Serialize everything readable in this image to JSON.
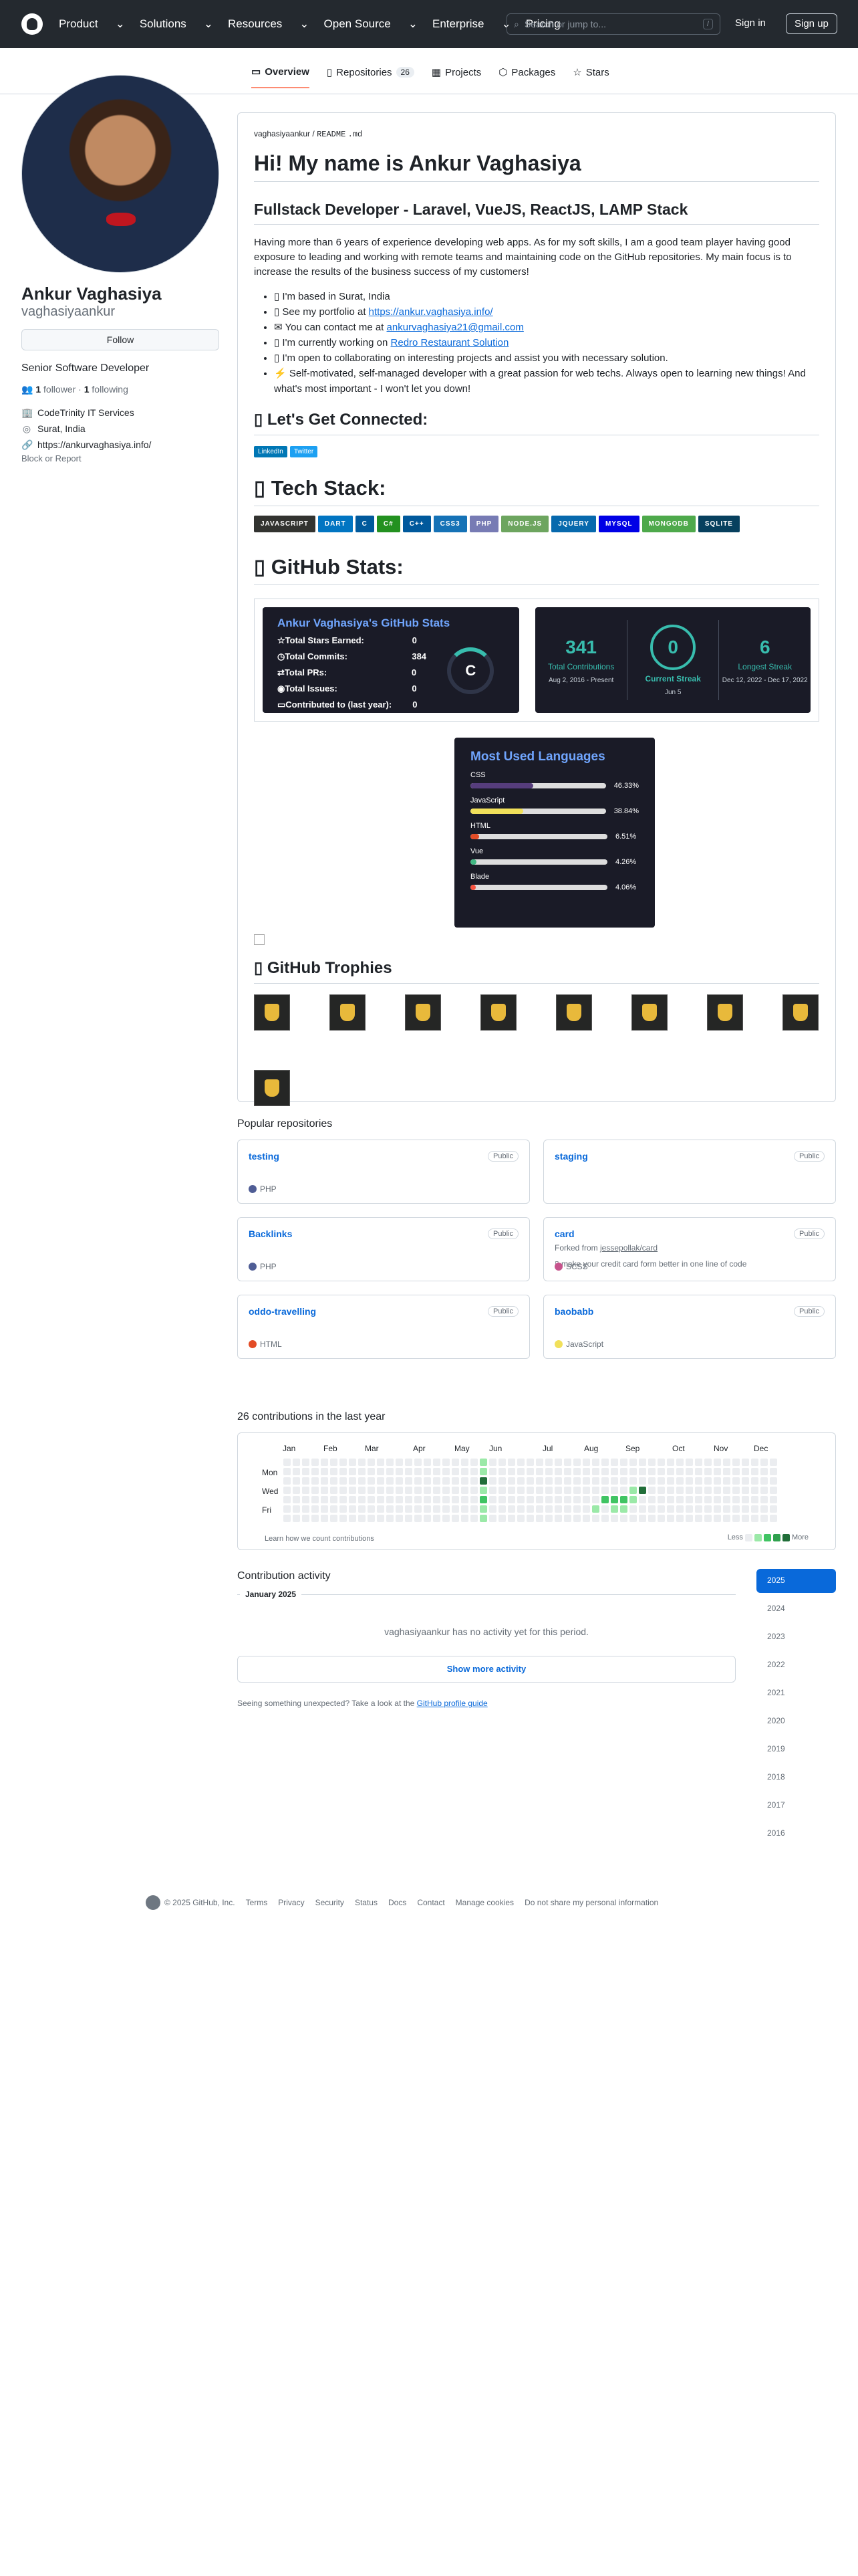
{
  "header": {
    "nav": [
      "Product",
      "Solutions",
      "Resources",
      "Open Source",
      "Enterprise",
      "Pricing"
    ],
    "search_placeholder": "Search or jump to...",
    "search_key": "/",
    "signin": "Sign in",
    "signup": "Sign up"
  },
  "tabs": [
    {
      "label": "Overview"
    },
    {
      "label": "Repositories",
      "count": "26"
    },
    {
      "label": "Projects"
    },
    {
      "label": "Packages"
    },
    {
      "label": "Stars"
    }
  ],
  "profile": {
    "name": "Ankur Vaghasiya",
    "username": "vaghasiyaankur",
    "follow": "Follow",
    "bio": "Senior Software Developer",
    "followers": "1",
    "followers_label": "follower",
    "following": "1",
    "following_label": "following",
    "company": "CodeTrinity IT Services",
    "location": "Surat, India",
    "website": "https://ankurvaghasiya.info/",
    "block": "Block or Report"
  },
  "readme": {
    "path_user": "vaghasiyaankur",
    "path_file": "README",
    "path_ext": ".md",
    "h1": "Hi! My name is Ankur Vaghasiya",
    "h2": "Fullstack Developer - Laravel, VueJS, ReactJS, LAMP Stack",
    "intro": "Having more than 6 years of experience developing web apps. As for my soft skills, I am a good team player having good exposure to leading and working with remote teams and maintaining code on the GitHub repositories. My main focus is to increase the results of the business success of my customers!",
    "bullets": [
      {
        "t": "I'm based in Surat, India"
      },
      {
        "t": "See my portfolio at ",
        "l": "https://ankur.vaghasiya.info/"
      },
      {
        "t": "You can contact me at ",
        "l": "ankurvaghasiya21@gmail.com"
      },
      {
        "t": "I'm currently working on ",
        "l": "Redro Restaurant Solution"
      },
      {
        "t": "I'm open to collaborating on interesting projects and assist you with necessary solution."
      },
      {
        "t": "Self-motivated, self-managed developer with a great passion for web techs. Always open to learning new things! And what's most important - I won't let you down!"
      }
    ],
    "connect": "Let's Get Connected:",
    "connect_badges": [
      "LinkedIn",
      "Twitter"
    ],
    "techstack": "Tech Stack:",
    "tech": [
      {
        "n": "JAVASCRIPT",
        "c": "#323330"
      },
      {
        "n": "DART",
        "c": "#0175C2"
      },
      {
        "n": "C",
        "c": "#00599C"
      },
      {
        "n": "C#",
        "c": "#239120"
      },
      {
        "n": "C++",
        "c": "#00599C"
      },
      {
        "n": "CSS3",
        "c": "#1572B6"
      },
      {
        "n": "PHP",
        "c": "#777BB4"
      },
      {
        "n": "NODE.JS",
        "c": "#6DA55F"
      },
      {
        "n": "JQUERY",
        "c": "#0769AD"
      },
      {
        "n": "MYSQL",
        "c": "#0000E6"
      },
      {
        "n": "MONGODB",
        "c": "#4ea94b"
      },
      {
        "n": "SQLITE",
        "c": "#07405e"
      }
    ],
    "stats_h": "GitHub Stats:",
    "trophies_h": "GitHub Trophies"
  },
  "stats": {
    "title": "Ankur Vaghasiya's GitHub Stats",
    "rows": [
      {
        "l": "Total Stars Earned:",
        "v": "0"
      },
      {
        "l": "Total Commits:",
        "v": "384"
      },
      {
        "l": "Total PRs:",
        "v": "0"
      },
      {
        "l": "Total Issues:",
        "v": "0"
      },
      {
        "l": "Contributed to (last year):",
        "v": "0"
      }
    ],
    "grade": "C"
  },
  "streak": {
    "total": "341",
    "total_l": "Total Contributions",
    "total_d": "Aug 2, 2016 - Present",
    "cur": "0",
    "cur_l": "Current Streak",
    "cur_d": "Jun 5",
    "long": "6",
    "long_l": "Longest Streak",
    "long_d": "Dec 12, 2022 - Dec 17, 2022"
  },
  "langs": {
    "title": "Most Used Languages",
    "items": [
      {
        "n": "CSS",
        "p": "46.33%",
        "v": 46.33,
        "c": "#563d7c"
      },
      {
        "n": "JavaScript",
        "p": "38.84%",
        "v": 38.84,
        "c": "#f1e05a"
      },
      {
        "n": "HTML",
        "p": "6.51%",
        "v": 6.51,
        "c": "#e34c26"
      },
      {
        "n": "Vue",
        "p": "4.26%",
        "v": 4.26,
        "c": "#41b883"
      },
      {
        "n": "Blade",
        "p": "4.06%",
        "v": 4.06,
        "c": "#f7523f"
      }
    ]
  },
  "popular": "Popular repositories",
  "repos": [
    {
      "n": "testing",
      "lang": "PHP",
      "lc": "#4F5D95"
    },
    {
      "n": "staging"
    },
    {
      "n": "Backlinks",
      "lang": "PHP",
      "lc": "#4F5D95"
    },
    {
      "n": "card",
      "fork": "Forked from ",
      "forksrc": "jessepollak/card",
      "desc": "make your credit card form better in one line of code",
      "lang": "SCSS",
      "lc": "#c6538c"
    },
    {
      "n": "oddo-travelling",
      "lang": "HTML",
      "lc": "#e34c26"
    },
    {
      "n": "baobabb",
      "lang": "JavaScript",
      "lc": "#f1e05a"
    }
  ],
  "public": "Public",
  "contrib": {
    "heading": "26 contributions in the last year",
    "months": [
      "Jan",
      "Feb",
      "Mar",
      "Apr",
      "May",
      "Jun",
      "Jul",
      "Aug",
      "Sep",
      "Oct",
      "Nov",
      "Dec"
    ],
    "days": [
      "Mon",
      "Wed",
      "Fri"
    ],
    "learn": "Learn how we count contributions",
    "less": "Less",
    "more": "More"
  },
  "activity": {
    "heading": "Contribution activity",
    "month": "January 2025",
    "none": "vaghasiyaankur has no activity yet for this period.",
    "show": "Show more activity",
    "unexpected": "Seeing something unexpected? Take a look at the ",
    "guide": "GitHub profile guide",
    "years": [
      "2025",
      "2024",
      "2023",
      "2022",
      "2021",
      "2020",
      "2019",
      "2018",
      "2017",
      "2016"
    ]
  },
  "footer": [
    "© 2025 GitHub, Inc.",
    "Terms",
    "Privacy",
    "Security",
    "Status",
    "Docs",
    "Contact",
    "Manage cookies",
    "Do not share my personal information"
  ]
}
